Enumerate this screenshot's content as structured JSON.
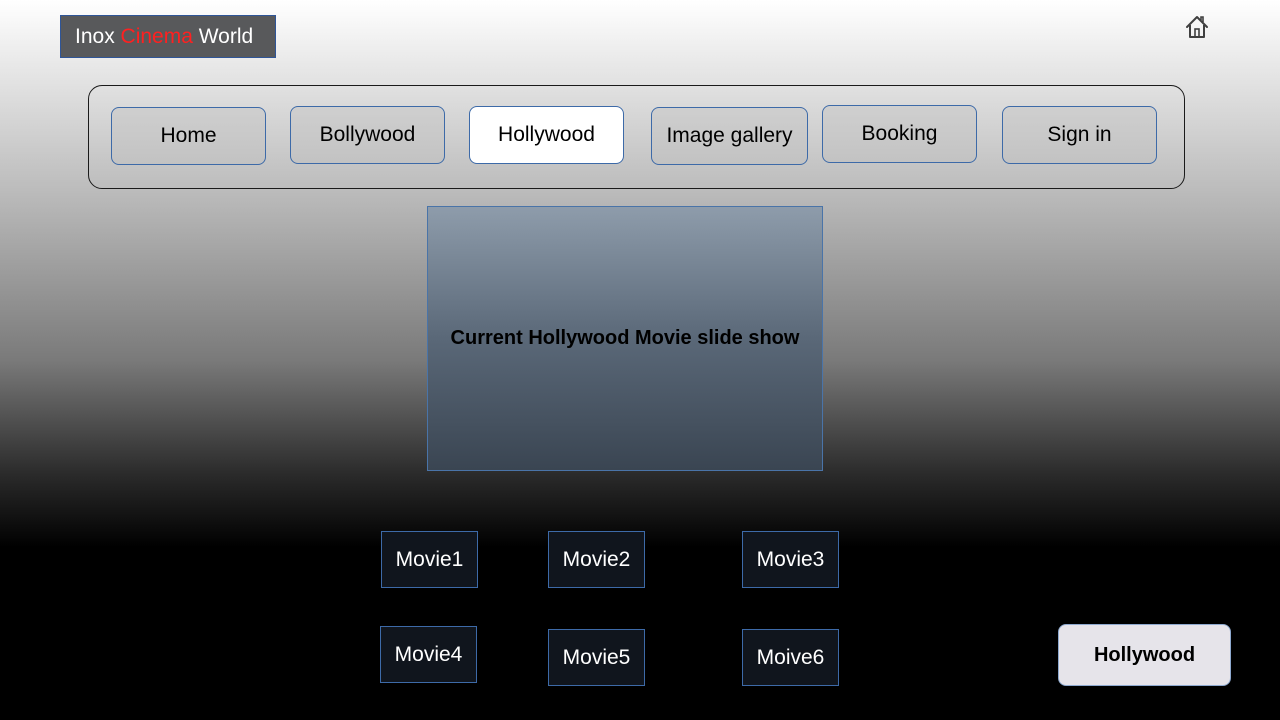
{
  "logo": {
    "part1": "Inox ",
    "part2": "Cinema",
    "part3": " World",
    "accent_color": "#ff2020"
  },
  "header": {
    "home_icon": "home-icon"
  },
  "nav": {
    "items": [
      {
        "label": "Home"
      },
      {
        "label": "Bollywood"
      },
      {
        "label": "Hollywood"
      },
      {
        "label": "Image gallery"
      },
      {
        "label": "Booking"
      },
      {
        "label": "Sign in"
      }
    ],
    "active": "Hollywood"
  },
  "slideshow": {
    "text": "Current Hollywood Movie slide show"
  },
  "movies": [
    {
      "label": "Movie1"
    },
    {
      "label": "Movie2"
    },
    {
      "label": "Movie3"
    },
    {
      "label": "Movie4"
    },
    {
      "label": "Movie5"
    },
    {
      "label": "Moive6"
    }
  ],
  "category_badge": {
    "label": "Hollywood"
  }
}
